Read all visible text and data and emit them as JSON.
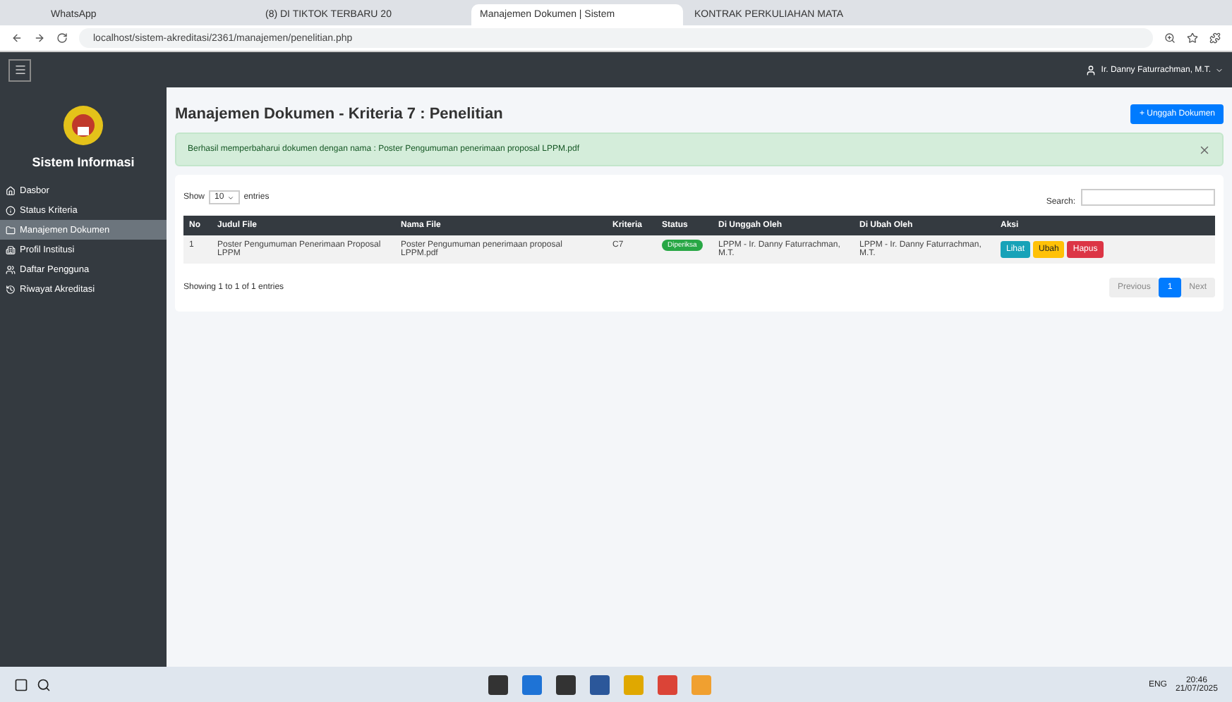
{
  "browser": {
    "tabs": [
      {
        "label": "WhatsApp",
        "selected": false
      },
      {
        "label": "(8) DI TIKTOK TERBARU 20",
        "selected": false
      },
      {
        "label": "Manajemen Dokumen | Sistem",
        "selected": true
      },
      {
        "label": "KONTRAK PERKULIAHAN MATA",
        "selected": false
      }
    ],
    "url": "localhost/sistem-akreditasi/2361/manajemen/penelitian.php"
  },
  "navbar": {
    "user": "Ir. Danny Faturrachman, M.T."
  },
  "sidebar": {
    "title": "Sistem Informasi",
    "items": [
      {
        "label": "Dasbor",
        "selected": false
      },
      {
        "label": "Status Kriteria",
        "selected": false
      },
      {
        "label": "Manajemen Dokumen",
        "selected": true
      },
      {
        "label": "Profil Institusi",
        "selected": false
      },
      {
        "label": "Daftar Pengguna",
        "selected": false
      },
      {
        "label": "Riwayat Akreditasi",
        "selected": false
      }
    ]
  },
  "page": {
    "title": "Manajemen Dokumen - Kriteria 7 : Penelitian",
    "upload_button": "+ Unggah Dokumen",
    "alert": "Berhasil memperbaharui dokumen dengan nama : Poster Pengumuman penerimaan proposal LPPM.pdf",
    "show_label": "Show",
    "entries_value": "10",
    "entries_label": "entries",
    "search_label": "Search:",
    "table": {
      "columns": [
        "No",
        "Judul File",
        "Nama File",
        "Kriteria",
        "Status",
        "Di Unggah Oleh",
        "Di Ubah Oleh",
        "Aksi"
      ],
      "rows": [
        {
          "no": "1",
          "judul": "Poster Pengumuman Penerimaan Proposal LPPM",
          "nama": "Poster Pengumuman penerimaan proposal LPPM.pdf",
          "kriteria": "C7",
          "status": "Diperiksa",
          "uploaded_by": "LPPM - Ir. Danny Faturrachman, M.T.",
          "changed_by": "LPPM - Ir. Danny Faturrachman, M.T.",
          "actions": [
            "Lihat",
            "Ubah",
            "Hapus"
          ]
        }
      ]
    },
    "info": "Showing 1 to 1 of 1 entries",
    "pagination": {
      "previous": "Previous",
      "pages": [
        {
          "label": "1",
          "selected": true
        }
      ],
      "next": "Next"
    }
  },
  "taskbar": {
    "language": "ENG",
    "time": "20:46",
    "date": "21/07/2025"
  }
}
